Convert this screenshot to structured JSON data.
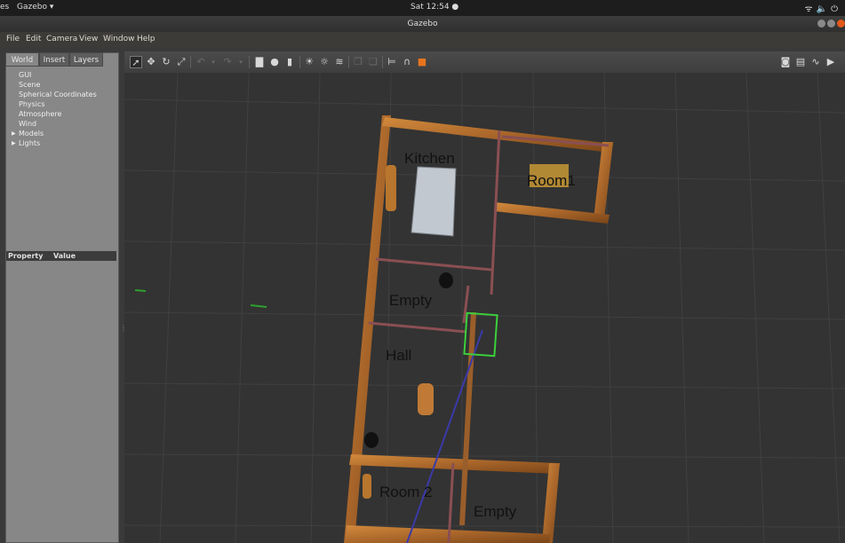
{
  "os_bar": {
    "activities": "es",
    "app_menu": "Gazebo ▾",
    "clock": "Sat 12:54 ●"
  },
  "window": {
    "title": "Gazebo"
  },
  "menu": [
    "File",
    "Edit",
    "Camera",
    "View",
    "Window",
    "Help"
  ],
  "left_panel": {
    "tabs": [
      "World",
      "Insert",
      "Layers"
    ],
    "active_tab": "World",
    "tree": [
      {
        "label": "GUI",
        "expandable": false
      },
      {
        "label": "Scene",
        "expandable": false
      },
      {
        "label": "Spherical Coordinates",
        "expandable": false
      },
      {
        "label": "Physics",
        "expandable": false
      },
      {
        "label": "Atmosphere",
        "expandable": false
      },
      {
        "label": "Wind",
        "expandable": false
      },
      {
        "label": "Models",
        "expandable": true
      },
      {
        "label": "Lights",
        "expandable": true
      }
    ],
    "property_header": {
      "property": "Property",
      "value": "Value"
    }
  },
  "toolbar": {
    "left_tools": [
      "select-arrow-icon",
      "translate-icon",
      "rotate-icon",
      "scale-icon",
      "undo-icon",
      "redo-icon",
      "box-shape-icon",
      "sphere-shape-icon",
      "cylinder-shape-icon",
      "point-light-icon",
      "spot-light-icon",
      "directional-light-icon",
      "copy-icon",
      "paste-icon",
      "align-icon",
      "snap-icon",
      "change-view-icon"
    ],
    "right_tools": [
      "screenshot-icon",
      "log-icon",
      "plot-icon",
      "video-record-icon"
    ],
    "accent_color": "#e8741e"
  },
  "scene": {
    "room_labels": [
      "Kitchen",
      "Room1",
      "Empty",
      "Hall",
      "Room 2",
      "Empty"
    ],
    "wall_color": "#b7732e",
    "selection_color": "#3bd13b",
    "grid_color": "#404040",
    "background_color": "#333333"
  }
}
